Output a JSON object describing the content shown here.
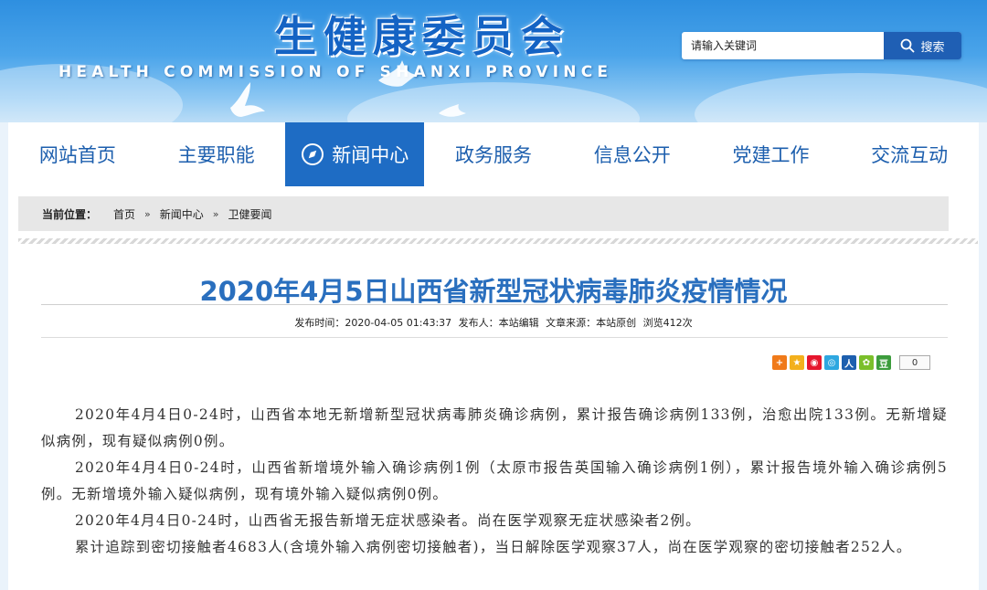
{
  "header": {
    "title_cn": "生健康委员会",
    "title_en": "HEALTH COMMISSION OF SHANXI PROVINCE",
    "search": {
      "placeholder": "请输入关键词",
      "button_label": "搜索"
    }
  },
  "nav": {
    "items": [
      {
        "label": "网站首页",
        "active": false
      },
      {
        "label": "主要职能",
        "active": false
      },
      {
        "label": "新闻中心",
        "active": true
      },
      {
        "label": "政务服务",
        "active": false
      },
      {
        "label": "信息公开",
        "active": false
      },
      {
        "label": "党建工作",
        "active": false
      },
      {
        "label": "交流互动",
        "active": false
      }
    ]
  },
  "breadcrumb": {
    "prefix": "当前位置：",
    "items": [
      "首页",
      "新闻中心",
      "卫健要闻"
    ],
    "separator": "»"
  },
  "article": {
    "title": "2020年4月5日山西省新型冠状病毒肺炎疫情情况",
    "meta": {
      "publish_time": "发布时间：2020-04-05 01:43:37",
      "publisher": "发布人：本站编辑",
      "source": "文章来源：本站原创",
      "views": "浏览412次"
    },
    "share_count": "0",
    "paragraphs": [
      "2020年4月4日0-24时，山西省本地无新增新型冠状病毒肺炎确诊病例，累计报告确诊病例133例，治愈出院133例。无新增疑似病例，现有疑似病例0例。",
      "2020年4月4日0-24时，山西省新增境外输入确诊病例1例（太原市报告英国输入确诊病例1例），累计报告境外输入确诊病例5例。无新增境外输入疑似病例，现有境外输入疑似病例0例。",
      "2020年4月4日0-24时，山西省无报告新增无症状感染者。尚在医学观察无症状感染者2例。",
      "累计追踪到密切接触者4683人(含境外输入病例密切接触者)，当日解除医学观察37人，尚在医学观察的密切接触者252人。"
    ]
  },
  "colors": {
    "header_blue": "#2e8fe0",
    "nav_active": "#1e6cc4",
    "nav_text": "#1d5fae",
    "title_blue": "#2a6fbe",
    "search_button": "#1f5fb4"
  }
}
